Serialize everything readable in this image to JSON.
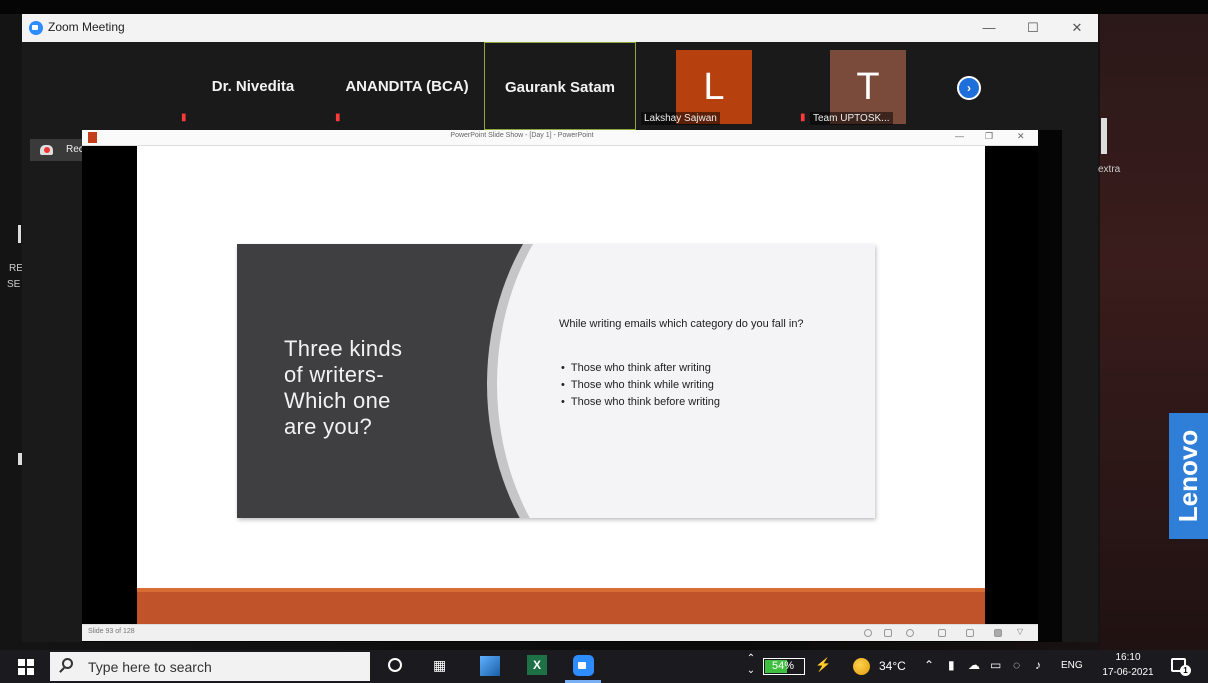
{
  "zoom": {
    "window_title": "Zoom Meeting",
    "participants": [
      {
        "name": "Dr. Nivedita"
      },
      {
        "name": "ANANDITA (BCA)"
      },
      {
        "name": "Gaurank Satam"
      },
      {
        "initial": "L",
        "label": "Lakshay Sajwan",
        "color": "#b7410e"
      },
      {
        "initial": "T",
        "label": "Team UPTOSK...",
        "color": "#7a4a3a"
      }
    ],
    "recording_label": "Recording..."
  },
  "powerpoint": {
    "title": "PowerPoint Slide Show - [Day 1] - PowerPoint",
    "slide_counter": "Slide 93 of 128",
    "slide": {
      "heading": "Three kinds\nof writers-\nWhich one\nare you?",
      "question": "While writing emails which category do you fall in?",
      "bullets": [
        "Those who think after writing",
        "Those who think while writing",
        "Those who think before writing"
      ]
    }
  },
  "background": {
    "right_text": "extra",
    "left_text_1": "RE",
    "left_text_2": "SE"
  },
  "brand": "Lenovo",
  "taskbar": {
    "search_placeholder": "Type here to search",
    "battery_percent": "54%",
    "battery_level": 0.54,
    "temperature": "34°C",
    "language": "ENG",
    "time": "16:10",
    "date": "17-06-2021",
    "notification_count": "1"
  }
}
